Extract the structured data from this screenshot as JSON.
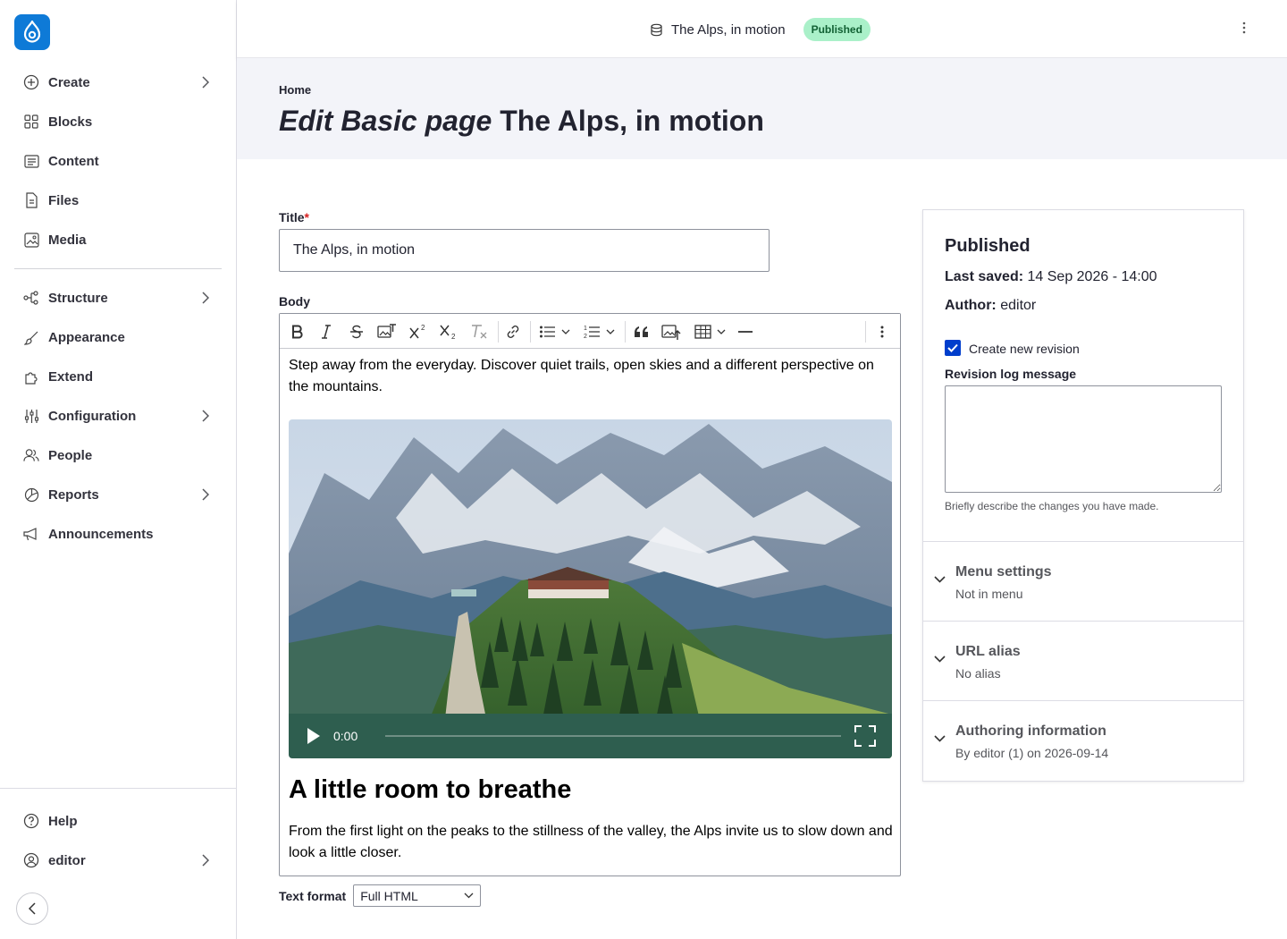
{
  "topbar": {
    "title": "The Alps, in motion",
    "status": "Published"
  },
  "sidebar": {
    "items": [
      {
        "label": "Create",
        "icon": "plus-circle-icon",
        "has_children": true
      },
      {
        "label": "Blocks",
        "icon": "blocks-icon",
        "has_children": false
      },
      {
        "label": "Content",
        "icon": "content-icon",
        "has_children": false
      },
      {
        "label": "Files",
        "icon": "files-icon",
        "has_children": false
      },
      {
        "label": "Media",
        "icon": "media-icon",
        "has_children": false
      },
      {
        "label": "Structure",
        "icon": "structure-icon",
        "has_children": true
      },
      {
        "label": "Appearance",
        "icon": "brush-icon",
        "has_children": false
      },
      {
        "label": "Extend",
        "icon": "puzzle-icon",
        "has_children": false
      },
      {
        "label": "Configuration",
        "icon": "sliders-icon",
        "has_children": true
      },
      {
        "label": "People",
        "icon": "people-icon",
        "has_children": false
      },
      {
        "label": "Reports",
        "icon": "pie-chart-icon",
        "has_children": true
      },
      {
        "label": "Announcements",
        "icon": "megaphone-icon",
        "has_children": false
      }
    ],
    "footer": [
      {
        "label": "Help",
        "icon": "help-icon",
        "has_children": false
      },
      {
        "label": "editor",
        "icon": "user-icon",
        "has_children": true
      }
    ]
  },
  "header": {
    "breadcrumb": "Home",
    "title_prefix": "Edit Basic page",
    "title_name": "The Alps, in motion"
  },
  "form": {
    "title_label": "Title",
    "title_required": "*",
    "title_value": "The Alps, in motion",
    "body_label": "Body",
    "body": {
      "intro": "Step away from the everyday. Discover quiet trails, open skies and a different perspective on the mountains.",
      "video_time": "0:00",
      "heading": "A little room to breathe",
      "outro": "From the first light on the peaks to the stillness of the valley, the Alps invite us to slow down and look a little closer."
    },
    "text_format_label": "Text format",
    "text_format_value": "Full HTML"
  },
  "meta": {
    "status": "Published",
    "last_saved_label": "Last saved:",
    "last_saved_value": "14 Sep 2026 - 14:00",
    "author_label": "Author:",
    "author_value": "editor",
    "create_revision_label": "Create new revision",
    "create_revision_checked": true,
    "revision_log_label": "Revision log message",
    "revision_log_help": "Briefly describe the changes you have made.",
    "accordions": [
      {
        "title": "Menu settings",
        "summary": "Not in menu"
      },
      {
        "title": "URL alias",
        "summary": "No alias"
      },
      {
        "title": "Authoring information",
        "summary": "By editor (1) on 2026-09-14"
      }
    ]
  },
  "colors": {
    "brand": "#0e7ad7",
    "published_badge": "#aaf0c9",
    "checkbox": "#003ecc"
  }
}
